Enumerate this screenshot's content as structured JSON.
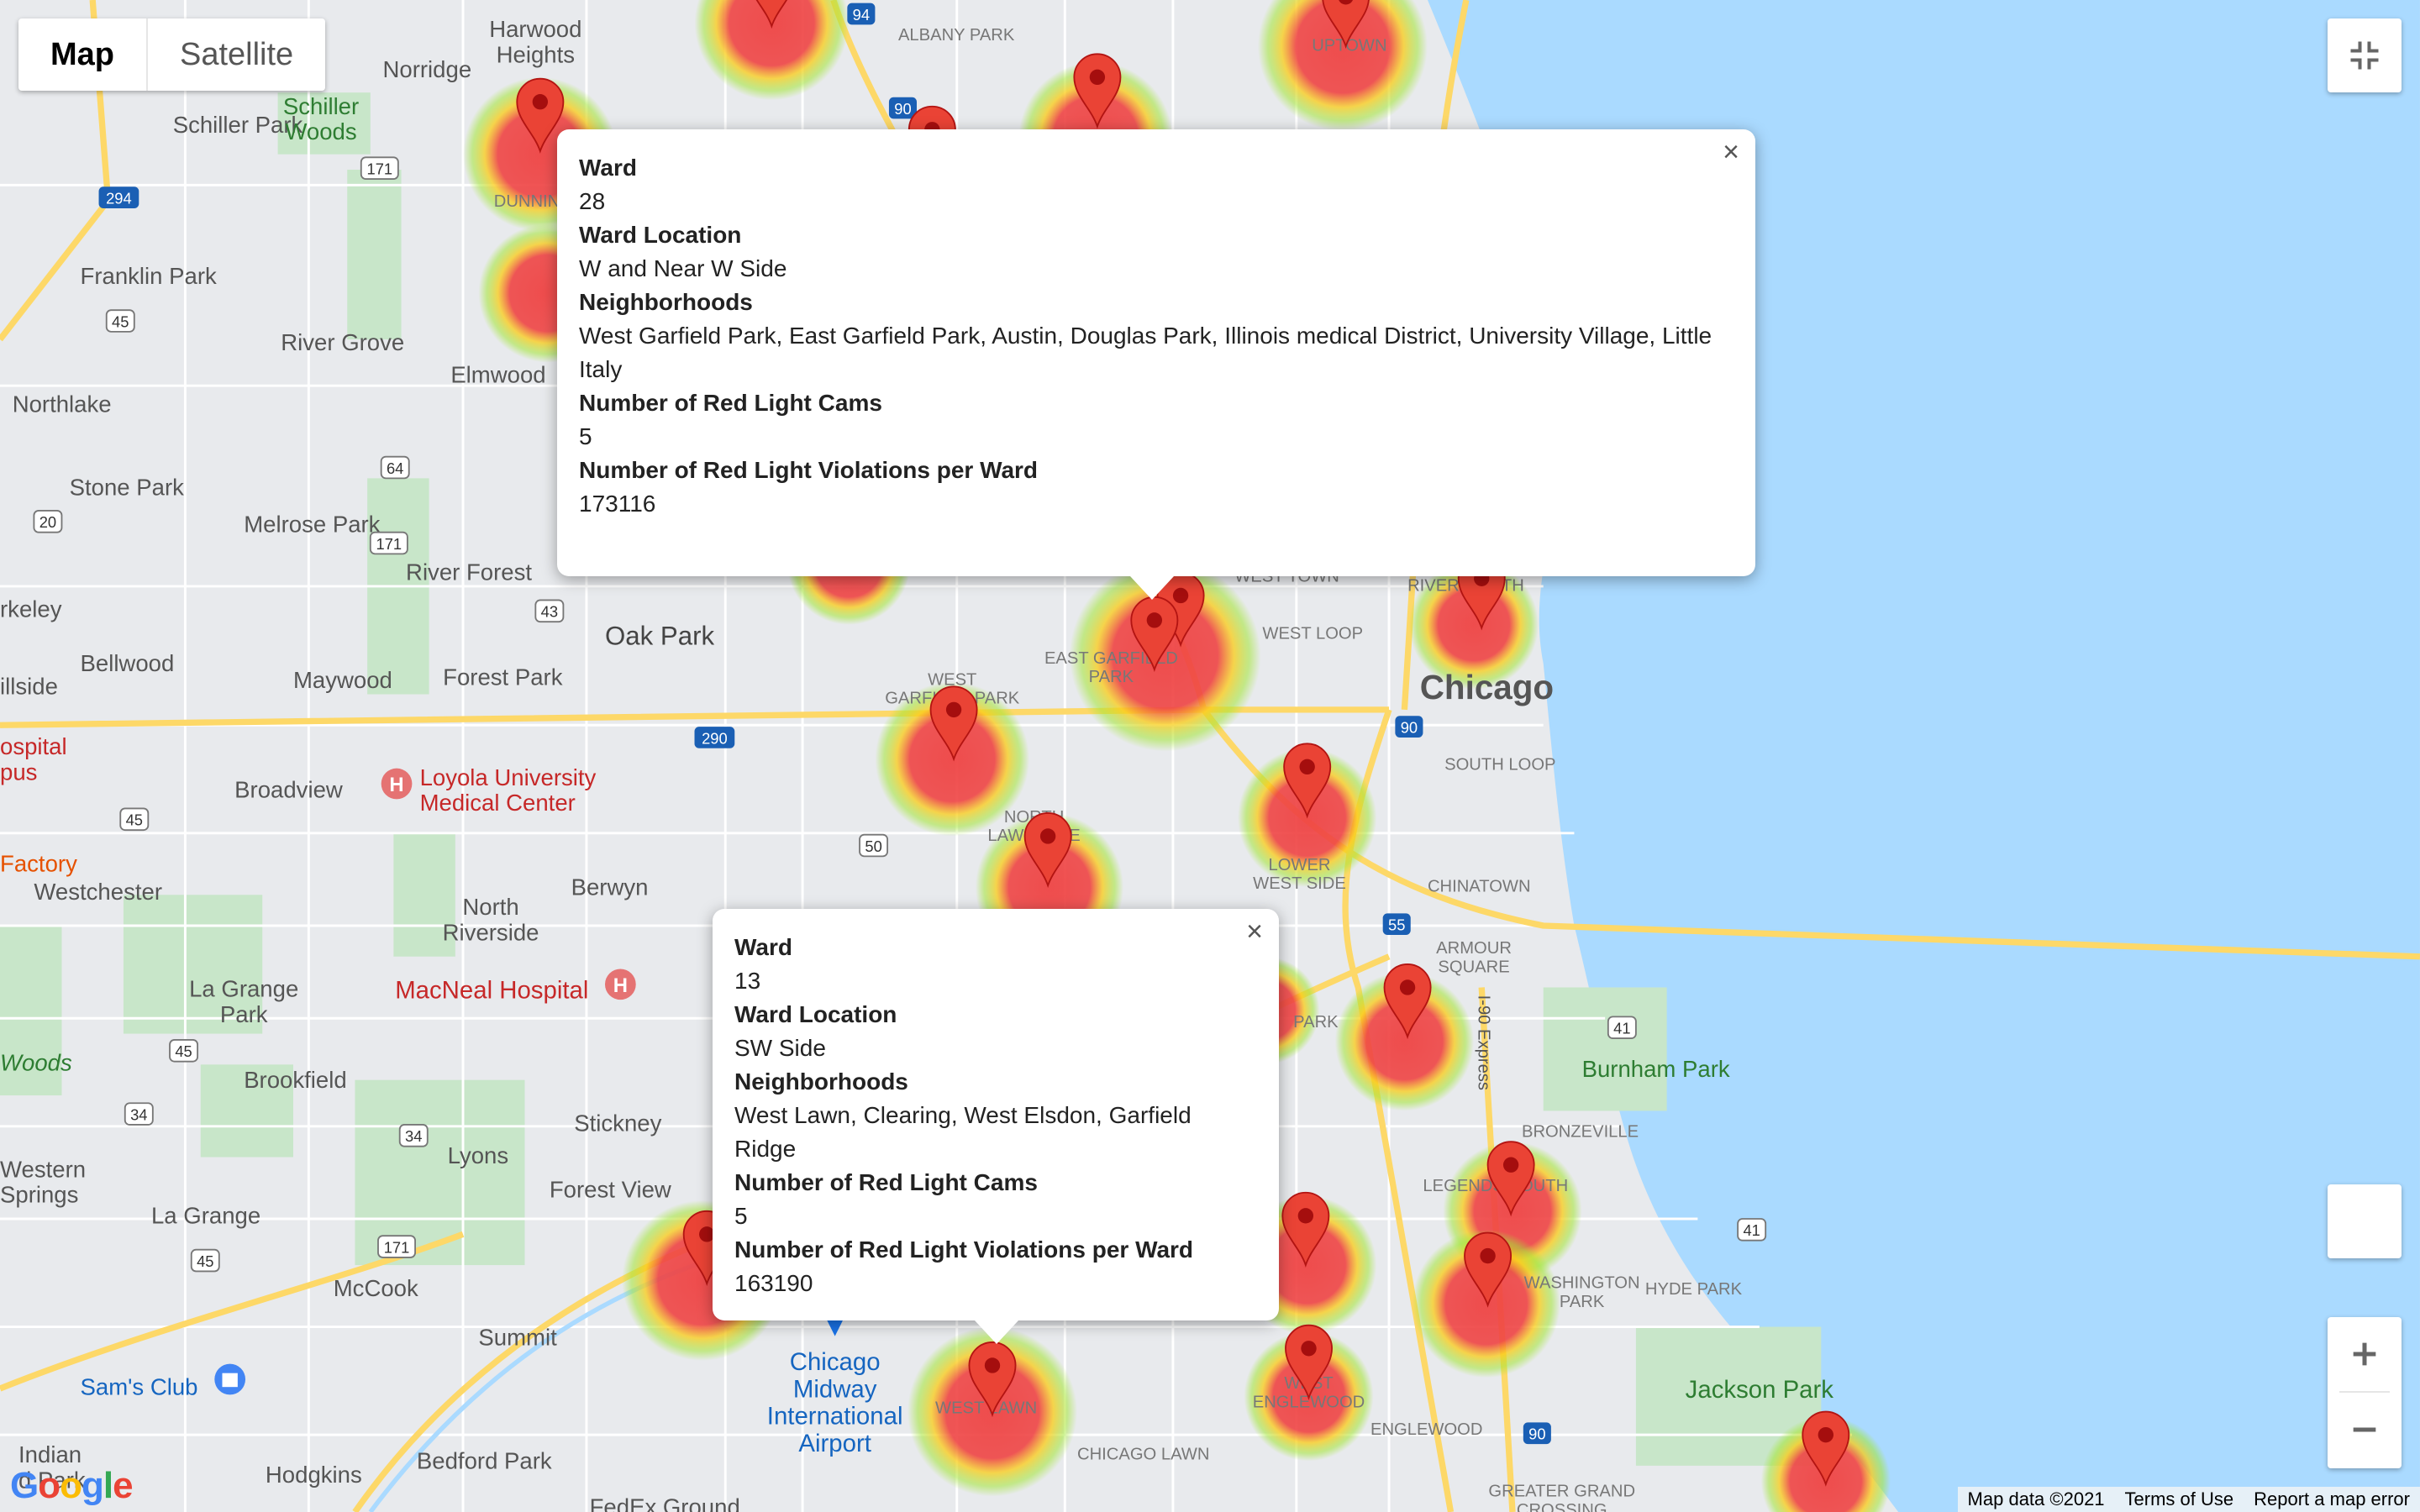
{
  "map_type": {
    "map_label": "Map",
    "satellite_label": "Satellite",
    "selected": "Map"
  },
  "colors": {
    "water": "#aadaff",
    "land": "#e8eaed",
    "park": "#c8e6c9",
    "highway": "#fdd868",
    "heat_core": "#ef4444",
    "heat_halo": "#a3e635",
    "marker": "#ea4335"
  },
  "icons": {
    "fullscreen": "fullscreen-icon",
    "zoom_in": "plus-icon",
    "zoom_out": "minus-icon",
    "marker": "map-pin-icon",
    "hospital": "hospital-icon",
    "shopping": "shopping-bag-icon",
    "close": "close-icon"
  },
  "places": {
    "harwood_heights": "Harwood\nHeights",
    "norridge": "Norridge",
    "schiller_park": "Schiller Park",
    "schiller_woods": "Schiller\nWoods",
    "franklin_park": "Franklin Park",
    "river_grove": "River Grove",
    "elmwood": "Elmwood",
    "northlake": "Northlake",
    "stone_park": "Stone Park",
    "melrose_park": "Melrose Park",
    "river_forest": "River Forest",
    "berkeley": "rkeley",
    "bellwood": "Bellwood",
    "maywood": "Maywood",
    "forest_park": "Forest Park",
    "oak_park": "Oak Park",
    "hillside": "illside",
    "hospital_campus": "ospital\npus",
    "broadview": "Broadview",
    "loyola": "Loyola University\nMedical Center",
    "factory": "Factory",
    "westchester": "Westchester",
    "berwyn": "Berwyn",
    "north_riverside": "North\nRiverside",
    "la_grange_park": "La Grange\nPark",
    "macneal": "MacNeal Hospital",
    "woods": "Woods",
    "brookfield": "Brookfield",
    "western_springs": "Western\nSprings",
    "lyons": "Lyons",
    "stickney": "Stickney",
    "forest_view": "Forest View",
    "la_grange": "La Grange",
    "mccook": "McCook",
    "summit": "Summit",
    "sams_club": "Sam's Club",
    "indian_head": "Indian\nd Park",
    "hodgkins": "Hodgkins",
    "bedford_park": "Bedford Park",
    "fedex": "FedEx Ground",
    "midway": "Chicago\nMidway\nInternational\nAirport",
    "chicago_lawn": "CHICAGO LAWN",
    "west_lawn": "WEST LAWN",
    "englewood": "ENGLEWOOD",
    "west_englewood": "WEST\nENGLEWOOD",
    "greater_grand_crossing": "GREATER GRAND\nCROSSING",
    "washington_park": "WASHINGTON\nPARK",
    "hyde_park": "HYDE PARK",
    "jackson_park": "Jackson Park",
    "bronzeville": "BRONZEVILLE",
    "legends_south": "LEGENDS SOUTH",
    "burnham_park": "Burnham Park",
    "armour_square": "ARMOUR\nSQUARE",
    "chinatown": "CHINATOWN",
    "lower_west_side": "LOWER\nWEST SIDE",
    "south_loop": "SOUTH LOOP",
    "chicago": "Chicago",
    "west_loop": "WEST LOOP",
    "west_town": "WEST TOWN",
    "river_north": "RIVER NORTH",
    "east_garfield_park": "EAST GARFIELD\nPARK",
    "west_garfield_park": "WEST\nGARFIELD PARK",
    "north_lawndale": "NORTH\nLAWNDALE",
    "uptown": "UPTOWN",
    "albany_park": "ALBANY PARK",
    "dunning": "DUNNING",
    "park_label": "PARK",
    "i90_express": "I-90 Express"
  },
  "shields": {
    "i94": "94",
    "i90": "90",
    "i294": "294",
    "i290": "290",
    "i55": "55",
    "us45": "45",
    "us34": "34",
    "us41": "41",
    "us20": "20",
    "s171": "171",
    "s64": "64",
    "s43": "43",
    "s50": "50"
  },
  "info_windows": [
    {
      "ward_label": "Ward",
      "ward": "28",
      "location_label": "Ward Location",
      "location": "W and Near W Side",
      "neighborhoods_label": "Neighborhoods",
      "neighborhoods": "West Garfield Park, East Garfield Park, Austin, Douglas Park, Illinois medical District, University Village, Little Italy",
      "cams_label": "Number of Red Light Cams",
      "cams": "5",
      "violations_label": "Number of Red Light Violations per Ward",
      "violations": "173116"
    },
    {
      "ward_label": "Ward",
      "ward": "13",
      "location_label": "Ward Location",
      "location": "SW Side",
      "neighborhoods_label": "Neighborhoods",
      "neighborhoods": "West Lawn, Clearing, West Elsdon, Garfield Ridge",
      "cams_label": "Number of Red Light Cams",
      "cams": "5",
      "violations_label": "Number of Red Light Violations per Ward",
      "violations": "163190"
    }
  ],
  "attribution": {
    "map_data": "Map data ©2021",
    "terms": "Terms of Use",
    "report": "Report a map error"
  },
  "logo": "Google"
}
